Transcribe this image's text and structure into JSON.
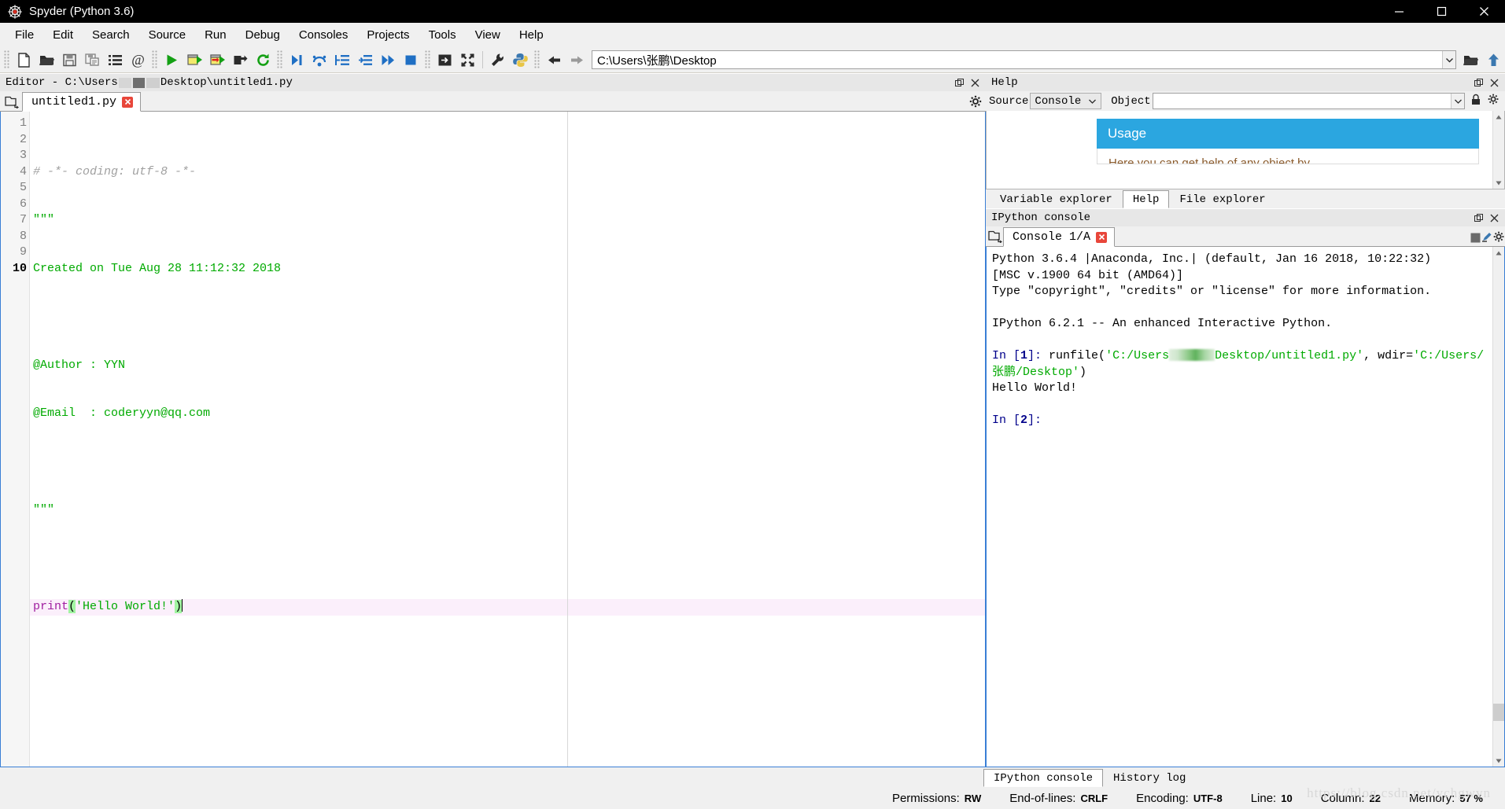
{
  "window": {
    "title": "Spyder (Python 3.6)",
    "logo_icon": "spider-logo",
    "minimize_icon": "minimize-icon",
    "maximize_icon": "maximize-icon",
    "close_icon": "close-icon"
  },
  "menubar": {
    "items": [
      {
        "label": "File"
      },
      {
        "label": "Edit"
      },
      {
        "label": "Search"
      },
      {
        "label": "Source"
      },
      {
        "label": "Run"
      },
      {
        "label": "Debug"
      },
      {
        "label": "Consoles"
      },
      {
        "label": "Projects"
      },
      {
        "label": "Tools"
      },
      {
        "label": "View"
      },
      {
        "label": "Help"
      }
    ]
  },
  "toolbar": {
    "buttons": [
      {
        "name": "new-file-icon"
      },
      {
        "name": "open-file-icon"
      },
      {
        "name": "save-file-icon"
      },
      {
        "name": "save-all-icon"
      },
      {
        "name": "file-switcher-icon"
      },
      {
        "name": "find-in-files-icon"
      },
      {
        "name": "run-file-icon"
      },
      {
        "name": "run-cell-icon"
      },
      {
        "name": "run-cell-advance-icon"
      },
      {
        "name": "run-selection-icon"
      },
      {
        "name": "rerun-last-cell-icon"
      },
      {
        "name": "debug-file-icon"
      },
      {
        "name": "debug-step-over-icon"
      },
      {
        "name": "debug-step-into-icon"
      },
      {
        "name": "debug-step-return-icon"
      },
      {
        "name": "debug-continue-icon"
      },
      {
        "name": "debug-stop-icon"
      },
      {
        "name": "maximize-pane-icon"
      },
      {
        "name": "fullscreen-icon"
      },
      {
        "name": "preferences-icon"
      },
      {
        "name": "pythonpath-manager-icon"
      },
      {
        "name": "back-icon"
      },
      {
        "name": "forward-icon"
      }
    ],
    "path": {
      "value": "C:\\Users\\张鹏\\Desktop",
      "dropdown_icon": "chevron-down-icon",
      "browse_icon": "open-folder-icon",
      "parent_icon": "parent-directory-icon"
    }
  },
  "editor": {
    "pane_title_prefix": "Editor - C:\\Users",
    "pane_title_suffix": "Desktop\\untitled1.py",
    "pane_title_redacted": true,
    "undock_icon": "undock-icon",
    "close_icon": "close-pane-icon",
    "browse_tabs_icon": "browse-tabs-icon",
    "options_icon": "gear-icon",
    "tab": {
      "label": "untitled1.py",
      "close_icon": "tab-close-icon"
    },
    "cursor": {
      "line": 10,
      "column": 22
    },
    "lines": [
      {
        "n": 1,
        "tokens": [
          {
            "t": "# -*- coding: utf-8 -*-",
            "c": "cm"
          }
        ]
      },
      {
        "n": 2,
        "tokens": [
          {
            "t": "\"\"\"",
            "c": "str"
          }
        ]
      },
      {
        "n": 3,
        "tokens": [
          {
            "t": "Created on Tue Aug 28 11:12:32 2018",
            "c": "str"
          }
        ]
      },
      {
        "n": 4,
        "tokens": [
          {
            "t": "",
            "c": "str"
          }
        ]
      },
      {
        "n": 5,
        "tokens": [
          {
            "t": "@Author : YYN",
            "c": "str"
          }
        ]
      },
      {
        "n": 6,
        "tokens": [
          {
            "t": "@Email  : coderyyn@qq.com",
            "c": "str"
          }
        ]
      },
      {
        "n": 7,
        "tokens": [
          {
            "t": "",
            "c": "str"
          }
        ]
      },
      {
        "n": 8,
        "tokens": [
          {
            "t": "\"\"\"",
            "c": "str"
          }
        ]
      },
      {
        "n": 9,
        "tokens": [
          {
            "t": "",
            "c": ""
          }
        ]
      },
      {
        "n": 10,
        "current": true,
        "tokens": [
          {
            "t": "print",
            "c": "kw-fn"
          },
          {
            "t": "(",
            "c": "paren-match"
          },
          {
            "t": "'Hello World!'",
            "c": "str"
          },
          {
            "t": ")",
            "c": "paren-match"
          }
        ]
      }
    ]
  },
  "help": {
    "pane_title": "Help",
    "source_label": "Source",
    "source_value": "Console",
    "source_caret_icon": "chevron-down-icon",
    "object_label": "Object",
    "object_value": "",
    "object_caret_icon": "chevron-down-icon",
    "lock_icon": "lock-icon",
    "options_icon": "gear-icon",
    "card": {
      "title": "Usage",
      "body_text": "Here you can get help of any object by"
    },
    "scroll_up_icon": "scroll-up-icon",
    "scroll_down_icon": "scroll-down-icon",
    "tabs": [
      {
        "label": "Variable explorer",
        "active": false
      },
      {
        "label": "Help",
        "active": true
      },
      {
        "label": "File explorer",
        "active": false
      }
    ]
  },
  "console": {
    "pane_title": "IPython console",
    "undock_icon": "undock-icon",
    "close_icon": "close-pane-icon",
    "browse_tabs_icon": "browse-tabs-icon",
    "tab": {
      "label": "Console 1/A",
      "close_icon": "tab-close-icon"
    },
    "stop_icon": "stop-icon",
    "clear_icon": "clear-console-icon",
    "options_icon": "gear-icon",
    "banner": [
      "Python 3.6.4 |Anaconda, Inc.| (default, Jan 16 2018, 10:22:32)",
      "[MSC v.1900 64 bit (AMD64)]",
      "Type \"copyright\", \"credits\" or \"license\" for more information.",
      "",
      "IPython 6.2.1 -- An enhanced Interactive Python.",
      ""
    ],
    "entries": [
      {
        "prompt_in": "In [",
        "prompt_num": "1",
        "prompt_close": "]:",
        "cmd_prefix": " runfile(",
        "path_start": "'C:/Users",
        "path_redacted": true,
        "path_mid": "Desktop/untitled1.py'",
        "cmd_sep": ", wdir=",
        "wdir": "'C:/Users/张鹏/Desktop'",
        "cmd_suffix": ")",
        "output": "Hello World!"
      }
    ],
    "next_prompt": {
      "prompt_in": "In [",
      "prompt_num": "2",
      "prompt_close": "]:"
    }
  },
  "bottom_tabs": [
    {
      "label": "IPython console",
      "active": true
    },
    {
      "label": "History log",
      "active": false
    }
  ],
  "statusbar": {
    "items": [
      {
        "key": "Permissions:",
        "value": "RW"
      },
      {
        "key": "End-of-lines:",
        "value": "CRLF"
      },
      {
        "key": "Encoding:",
        "value": "UTF-8"
      },
      {
        "key": "Line:",
        "value": "10"
      },
      {
        "key": "Column:",
        "value": "22"
      },
      {
        "key": "Memory:",
        "value": "57 %"
      }
    ],
    "watermark": "https://blog.csdn.net/ychgwvn"
  },
  "colors": {
    "accent_blue": "#2ba6e0",
    "focus_border": "#3a7fd5",
    "string_green": "#00aa00",
    "keyword_purple": "#a020a0",
    "current_line": "#fbeffb",
    "titlebar_bg": "#000000",
    "chrome_bg": "#f0f0f0"
  }
}
